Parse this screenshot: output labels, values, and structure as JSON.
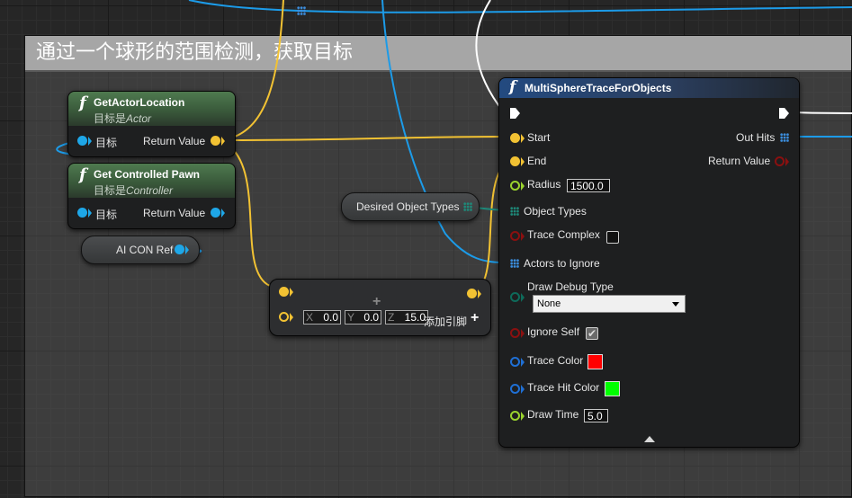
{
  "comment": {
    "title": "通过一个球形的范围检测，获取目标"
  },
  "get_actor_location": {
    "title": "GetActorLocation",
    "subtitle_prefix": "目标是",
    "subtitle_type": "Actor",
    "input_label": "目标",
    "output_label": "Return Value"
  },
  "get_controlled_pawn": {
    "title": "Get Controlled Pawn",
    "subtitle_prefix": "目标是",
    "subtitle_type": "Controller",
    "input_label": "目标",
    "output_label": "Return Value"
  },
  "ai_con_ref": {
    "label": "AI CON Ref"
  },
  "desired_object_types": {
    "label": "Desired Object Types"
  },
  "add_vector": {
    "x_axis": "X",
    "x_value": "0.0",
    "y_axis": "Y",
    "y_value": "0.0",
    "z_axis": "Z",
    "z_value": "15.0",
    "add_pin_label": "添加引脚",
    "add_pin_icon": "+"
  },
  "multi_sphere_trace": {
    "title": "MultiSphereTraceForObjects",
    "pins": {
      "start": "Start",
      "end": "End",
      "radius": "Radius",
      "radius_value": "1500.0",
      "object_types": "Object Types",
      "trace_complex": "Trace Complex",
      "actors_to_ignore": "Actors to Ignore",
      "draw_debug_type": "Draw Debug Type",
      "draw_debug_value": "None",
      "ignore_self": "Ignore Self",
      "trace_color": "Trace Color",
      "trace_hit_color": "Trace Hit Color",
      "draw_time": "Draw Time",
      "draw_time_value": "5.0",
      "out_hits": "Out Hits",
      "return_value": "Return Value"
    },
    "trace_complex_checked": false,
    "ignore_self_checked": true,
    "trace_color": "#ff0000",
    "trace_hit_color": "#00ff00"
  },
  "pin_colors": {
    "vector": "#f2c233",
    "object": "#1ea7e8",
    "float": "#9ad32e",
    "bool": "#8a1010",
    "struct": "#1f6fd4",
    "byte": "#0e6a5a"
  },
  "icons": {
    "function": "function-icon",
    "exec": "exec-pin-icon",
    "array": "array-pin-icon",
    "collapse": "collapse-arrow-icon",
    "check": "✔"
  }
}
